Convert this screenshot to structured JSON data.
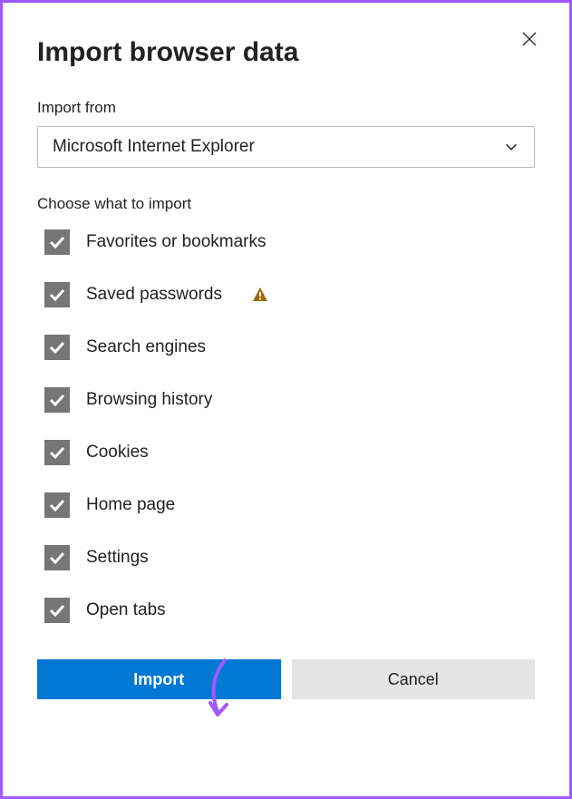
{
  "dialog": {
    "title": "Import browser data",
    "importFromLabel": "Import from",
    "selectedBrowser": "Microsoft Internet Explorer",
    "chooseLabel": "Choose what to import",
    "items": [
      {
        "label": "Favorites or bookmarks",
        "checked": true,
        "warning": false
      },
      {
        "label": "Saved passwords",
        "checked": true,
        "warning": true
      },
      {
        "label": "Search engines",
        "checked": true,
        "warning": false
      },
      {
        "label": "Browsing history",
        "checked": true,
        "warning": false
      },
      {
        "label": "Cookies",
        "checked": true,
        "warning": false
      },
      {
        "label": "Home page",
        "checked": true,
        "warning": false
      },
      {
        "label": "Settings",
        "checked": true,
        "warning": false
      },
      {
        "label": "Open tabs",
        "checked": true,
        "warning": false
      }
    ],
    "importButton": "Import",
    "cancelButton": "Cancel"
  }
}
